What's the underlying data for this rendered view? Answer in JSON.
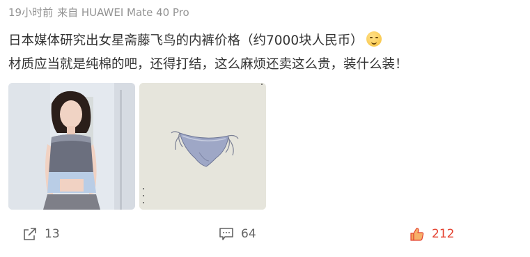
{
  "post": {
    "meta": {
      "time": "19小时前",
      "source": "来自 HUAWEI Mate 40 Pro"
    },
    "text_line1": "日本媒体研究出女星斋藤飞鸟的内裤价格（约7000块人民币）",
    "text_line2": "材质应当就是纯棉的吧，还得打结，这么麻烦还卖这么贵，装什么装！",
    "emoji_icon": "shushing-face-icon",
    "images": [
      {
        "type": "photo",
        "icon": "person-photo"
      },
      {
        "type": "photo",
        "icon": "product-photo"
      }
    ]
  },
  "actions": {
    "share": {
      "icon": "share-icon",
      "count": "13"
    },
    "comment": {
      "icon": "comment-icon",
      "count": "64"
    },
    "like": {
      "icon": "thumbs-up-icon",
      "count": "212",
      "color": "#e4412f"
    }
  }
}
